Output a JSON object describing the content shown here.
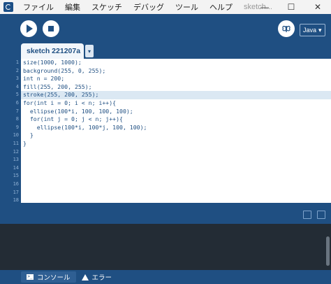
{
  "window": {
    "title": "sketch...",
    "menu": [
      "ファイル",
      "編集",
      "スケッチ",
      "デバッグ",
      "ツール",
      "ヘルプ"
    ],
    "controls": [
      "—",
      "☐",
      "✕"
    ]
  },
  "toolbar": {
    "mode": "Java"
  },
  "tab": {
    "name": "sketch 221207a",
    "menu_glyph": "▾"
  },
  "editor": {
    "current_line": 5,
    "lines": [
      "size(1000, 1000);",
      "background(255, 0, 255);",
      "int n = 200;",
      "fill(255, 200, 255);",
      "stroke(255, 200, 255);",
      "for(int i = 0; i < n; i++){",
      "  ellipse(100*i, 100, 100, 100);",
      "  for(int j = 0; j < n; j++){",
      "    ellipse(100*i, 100*j, 100, 100);",
      "  }",
      "}",
      "",
      "",
      "",
      "",
      "",
      "",
      ""
    ],
    "line_numbers": [
      "1",
      "2",
      "3",
      "4",
      "5",
      "6",
      "7",
      "8",
      "9",
      "10",
      "11",
      "12",
      "13",
      "14",
      "15",
      "16",
      "17",
      "18"
    ]
  },
  "console_tabs": {
    "console_label": "コンソール",
    "errors_label": "エラー"
  },
  "colors": {
    "toolbar": "#1f4f82",
    "editor_bg": "#ffffff",
    "console_bg": "#232c35"
  }
}
